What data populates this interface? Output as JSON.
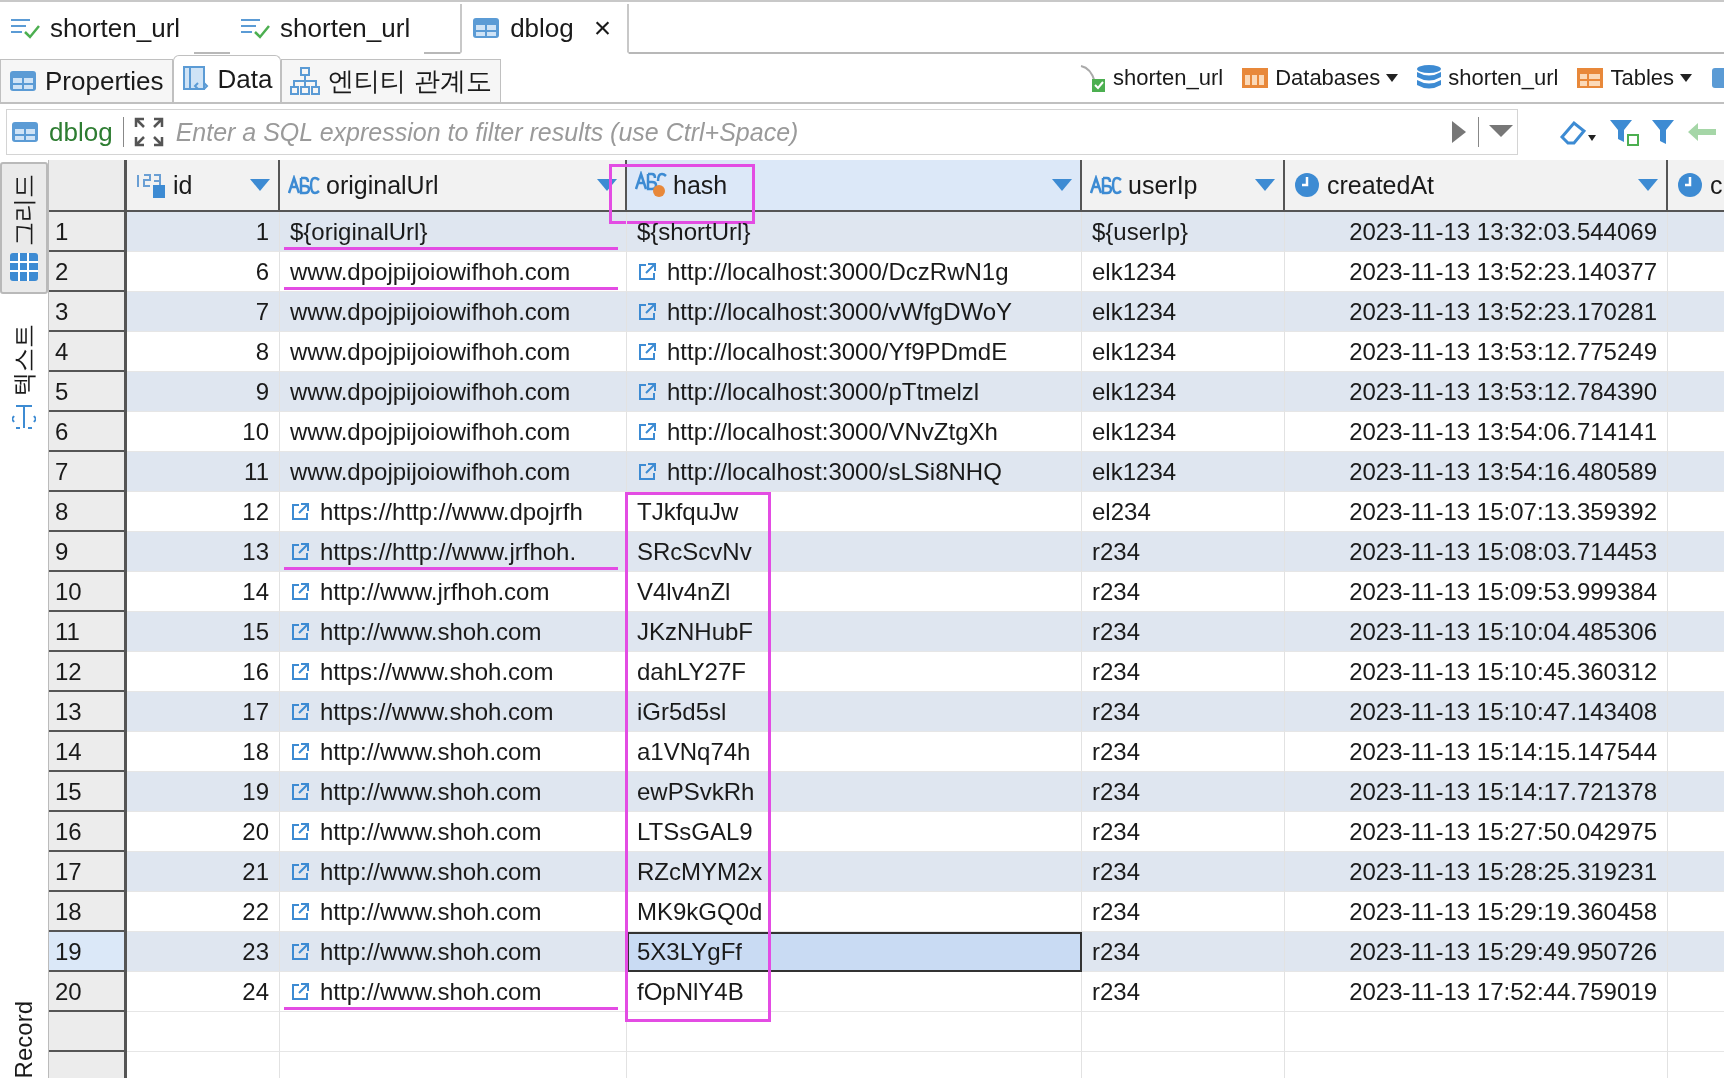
{
  "editor_tabs": [
    {
      "label": "shorten_url",
      "selected": false,
      "closable": false
    },
    {
      "label": "shorten_url",
      "selected": false,
      "closable": false
    },
    {
      "label": "dblog",
      "selected": true,
      "closable": true,
      "close": "×"
    }
  ],
  "sub_tabs": [
    {
      "label": "Properties",
      "selected": false
    },
    {
      "label": "Data",
      "selected": true
    },
    {
      "label": "엔티티 관계도",
      "selected": false
    }
  ],
  "breadcrumbs": [
    {
      "label": "shorten_url",
      "dropdown": false
    },
    {
      "label": "Databases",
      "dropdown": true
    },
    {
      "label": "shorten_url",
      "dropdown": false
    },
    {
      "label": "Tables",
      "dropdown": true
    }
  ],
  "filter": {
    "table": "dblog",
    "placeholder": "Enter a SQL expression to filter results (use Ctrl+Space)"
  },
  "side_tabs": [
    {
      "label": "그리드",
      "selected": true
    },
    {
      "label": "텍스트",
      "selected": false
    }
  ],
  "side_bottom": "Record",
  "columns": [
    {
      "label": "id",
      "selected": false,
      "marked": false
    },
    {
      "label": "originalUrl",
      "selected": false,
      "marked": false
    },
    {
      "label": "hash",
      "selected": true,
      "marked": true
    },
    {
      "label": "userIp",
      "selected": false,
      "marked": false
    },
    {
      "label": "createdAt",
      "selected": false,
      "marked": false
    },
    {
      "label": "c",
      "selected": false,
      "marked": false
    }
  ],
  "rows": [
    {
      "num": "1",
      "id": "1",
      "url": {
        "text": "${originalUrl}",
        "link": false,
        "marked": true
      },
      "hash": {
        "text": "${shortUrl}",
        "link": false,
        "marked": false
      },
      "userIp": "${userIp}",
      "createdAt": "2023-11-13 13:32:03.544069",
      "selected": false
    },
    {
      "num": "2",
      "id": "6",
      "url": {
        "text": "www.dpojpijoiowifhoh.com",
        "link": false,
        "marked": true
      },
      "hash": {
        "text": "http://localhost:3000/DczRwN1g",
        "link": true,
        "marked": false
      },
      "userIp": "elk1234",
      "createdAt": "2023-11-13 13:52:23.140377",
      "selected": false
    },
    {
      "num": "3",
      "id": "7",
      "url": {
        "text": "www.dpojpijoiowifhoh.com",
        "link": false,
        "marked": false
      },
      "hash": {
        "text": "http://localhost:3000/vWfgDWoY",
        "link": true,
        "marked": false
      },
      "userIp": "elk1234",
      "createdAt": "2023-11-13 13:52:23.170281",
      "selected": false
    },
    {
      "num": "4",
      "id": "8",
      "url": {
        "text": "www.dpojpijoiowifhoh.com",
        "link": false,
        "marked": false
      },
      "hash": {
        "text": "http://localhost:3000/Yf9PDmdE",
        "link": true,
        "marked": false
      },
      "userIp": "elk1234",
      "createdAt": "2023-11-13 13:53:12.775249",
      "selected": false
    },
    {
      "num": "5",
      "id": "9",
      "url": {
        "text": "www.dpojpijoiowifhoh.com",
        "link": false,
        "marked": false
      },
      "hash": {
        "text": "http://localhost:3000/pTtmelzl",
        "link": true,
        "marked": false
      },
      "userIp": "elk1234",
      "createdAt": "2023-11-13 13:53:12.784390",
      "selected": false
    },
    {
      "num": "6",
      "id": "10",
      "url": {
        "text": "www.dpojpijoiowifhoh.com",
        "link": false,
        "marked": false
      },
      "hash": {
        "text": "http://localhost:3000/VNvZtgXh",
        "link": true,
        "marked": false
      },
      "userIp": "elk1234",
      "createdAt": "2023-11-13 13:54:06.714141",
      "selected": false
    },
    {
      "num": "7",
      "id": "11",
      "url": {
        "text": "www.dpojpijoiowifhoh.com",
        "link": false,
        "marked": false
      },
      "hash": {
        "text": "http://localhost:3000/sLSi8NHQ",
        "link": true,
        "marked": false
      },
      "userIp": "elk1234",
      "createdAt": "2023-11-13 13:54:16.480589",
      "selected": false
    },
    {
      "num": "8",
      "id": "12",
      "url": {
        "text": "https://http://www.dpojrfh",
        "link": true,
        "marked": false
      },
      "hash": {
        "text": "TJkfquJw",
        "link": false,
        "marked": true
      },
      "userIp": "el234",
      "createdAt": "2023-11-13 15:07:13.359392",
      "selected": false
    },
    {
      "num": "9",
      "id": "13",
      "url": {
        "text": "https://http://www.jrfhoh.",
        "link": true,
        "marked": true
      },
      "hash": {
        "text": "SRcScvNv",
        "link": false,
        "marked": true
      },
      "userIp": "r234",
      "createdAt": "2023-11-13 15:08:03.714453",
      "selected": false
    },
    {
      "num": "10",
      "id": "14",
      "url": {
        "text": "http://www.jrfhoh.com",
        "link": true,
        "marked": false
      },
      "hash": {
        "text": "V4lv4nZl",
        "link": false,
        "marked": true
      },
      "userIp": "r234",
      "createdAt": "2023-11-13 15:09:53.999384",
      "selected": false
    },
    {
      "num": "11",
      "id": "15",
      "url": {
        "text": "http://www.shoh.com",
        "link": true,
        "marked": false
      },
      "hash": {
        "text": "JKzNHubF",
        "link": false,
        "marked": true
      },
      "userIp": "r234",
      "createdAt": "2023-11-13 15:10:04.485306",
      "selected": false
    },
    {
      "num": "12",
      "id": "16",
      "url": {
        "text": "https://www.shoh.com",
        "link": true,
        "marked": false
      },
      "hash": {
        "text": "dahLY27F",
        "link": false,
        "marked": true
      },
      "userIp": "r234",
      "createdAt": "2023-11-13 15:10:45.360312",
      "selected": false
    },
    {
      "num": "13",
      "id": "17",
      "url": {
        "text": "https://www.shoh.com",
        "link": true,
        "marked": false
      },
      "hash": {
        "text": "iGr5d5sl",
        "link": false,
        "marked": true
      },
      "userIp": "r234",
      "createdAt": "2023-11-13 15:10:47.143408",
      "selected": false
    },
    {
      "num": "14",
      "id": "18",
      "url": {
        "text": "http://www.shoh.com",
        "link": true,
        "marked": false
      },
      "hash": {
        "text": "a1VNq74h",
        "link": false,
        "marked": true
      },
      "userIp": "r234",
      "createdAt": "2023-11-13 15:14:15.147544",
      "selected": false
    },
    {
      "num": "15",
      "id": "19",
      "url": {
        "text": "http://www.shoh.com",
        "link": true,
        "marked": false
      },
      "hash": {
        "text": "ewPSvkRh",
        "link": false,
        "marked": true
      },
      "userIp": "r234",
      "createdAt": "2023-11-13 15:14:17.721378",
      "selected": false
    },
    {
      "num": "16",
      "id": "20",
      "url": {
        "text": "http://www.shoh.com",
        "link": true,
        "marked": false
      },
      "hash": {
        "text": "LTSsGAL9",
        "link": false,
        "marked": true
      },
      "userIp": "r234",
      "createdAt": "2023-11-13 15:27:50.042975",
      "selected": false
    },
    {
      "num": "17",
      "id": "21",
      "url": {
        "text": "http://www.shoh.com",
        "link": true,
        "marked": false
      },
      "hash": {
        "text": "RZcMYM2x",
        "link": false,
        "marked": true
      },
      "userIp": "r234",
      "createdAt": "2023-11-13 15:28:25.319231",
      "selected": false
    },
    {
      "num": "18",
      "id": "22",
      "url": {
        "text": "http://www.shoh.com",
        "link": true,
        "marked": false
      },
      "hash": {
        "text": "MK9kGQ0d",
        "link": false,
        "marked": true
      },
      "userIp": "r234",
      "createdAt": "2023-11-13 15:29:19.360458",
      "selected": false
    },
    {
      "num": "19",
      "id": "23",
      "url": {
        "text": "http://www.shoh.com",
        "link": true,
        "marked": false
      },
      "hash": {
        "text": "5X3LYgFf",
        "link": false,
        "marked": true
      },
      "userIp": "r234",
      "createdAt": "2023-11-13 15:29:49.950726",
      "selected": true
    },
    {
      "num": "20",
      "id": "24",
      "url": {
        "text": "http://www.shoh.com",
        "link": true,
        "marked": true
      },
      "hash": {
        "text": "fOpNlY4B",
        "link": false,
        "marked": true
      },
      "userIp": "r234",
      "createdAt": "2023-11-13 17:52:44.759019",
      "selected": false
    }
  ]
}
